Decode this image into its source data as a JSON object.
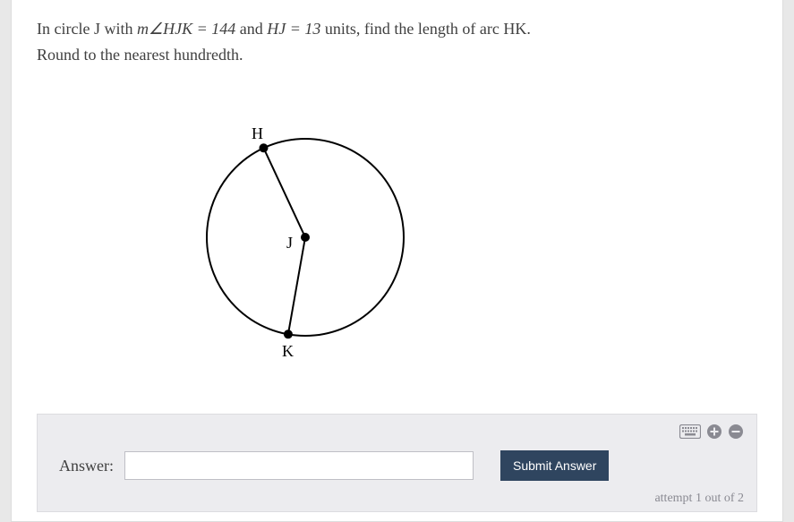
{
  "question": {
    "prefix": "In circle J with ",
    "angle_expr": "m∠HJK = 144",
    "mid": " and ",
    "radius_expr": "HJ = 13",
    "units": " units, find the length of arc HK.",
    "line2": "Round to the nearest hundredth."
  },
  "figure": {
    "labels": {
      "H": "H",
      "J": "J",
      "K": "K"
    }
  },
  "answer_panel": {
    "label": "Answer:",
    "input_value": "",
    "submit_label": "Submit Answer",
    "attempt_text": "attempt 1 out of 2"
  },
  "icons": {
    "keyboard": "keyboard-icon",
    "plus": "plus-icon",
    "minus": "minus-icon"
  }
}
